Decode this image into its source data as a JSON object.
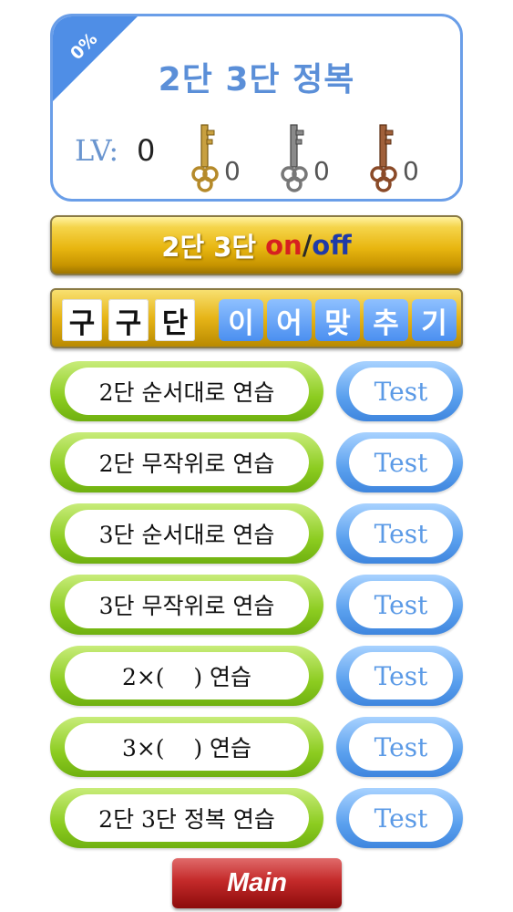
{
  "progress": {
    "percent_label": "0%"
  },
  "title": "2단 3단 정복",
  "level": {
    "label": "LV:",
    "value": "0"
  },
  "keys": [
    {
      "icon": "gold-key-icon",
      "color": "#c8a040",
      "count": "0"
    },
    {
      "icon": "silver-key-icon",
      "color": "#7d7d7d",
      "count": "0"
    },
    {
      "icon": "bronze-key-icon",
      "color": "#9c5a32",
      "count": "0"
    }
  ],
  "toggle": {
    "base": "2단 3단",
    "on": "on",
    "slash": "/",
    "off": "off"
  },
  "tabs": {
    "gugudan": [
      "구",
      "구",
      "단"
    ],
    "matching": [
      "이",
      "어",
      "맞",
      "추",
      "기"
    ]
  },
  "rows": [
    {
      "practice": "2단 순서대로 연습",
      "test": "Test"
    },
    {
      "practice": "2단 무작위로 연습",
      "test": "Test"
    },
    {
      "practice": "3단 순서대로 연습",
      "test": "Test"
    },
    {
      "practice": "3단 무작위로 연습",
      "test": "Test"
    },
    {
      "practice": "2×(    ) 연습",
      "test": "Test"
    },
    {
      "practice": "3×(    ) 연습",
      "test": "Test"
    },
    {
      "practice": "2단 3단 정복 연습",
      "test": "Test"
    }
  ],
  "main_button": "Main",
  "colors": {
    "accent_blue": "#4f8ee6",
    "gold": "#e6b417",
    "green": "#8ccc20",
    "red": "#c42a2a"
  }
}
